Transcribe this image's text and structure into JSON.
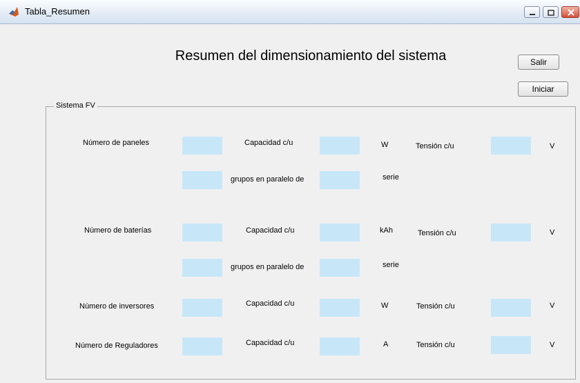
{
  "window": {
    "title": "Tabla_Resumen",
    "icon": "matlab-icon",
    "controls": [
      "minimize-icon",
      "maximize-icon",
      "close-icon"
    ]
  },
  "heading": "Resumen del dimensionamiento del sistema",
  "buttons": {
    "exit": "Salir",
    "start": "Iniciar"
  },
  "panel": {
    "title": "Sistema FV",
    "panels": {
      "label": "Número de paneles",
      "capacity_label": "Capacidad c/u",
      "capacity_unit": "W",
      "voltage_label": "Tensión c/u",
      "voltage_unit": "V",
      "groups_label": "grupos en  paralelo de",
      "series_label": "serie"
    },
    "batteries": {
      "label": "Número de baterías",
      "capacity_label": "Capacidad c/u",
      "capacity_unit": "kAh",
      "voltage_label": "Tensión c/u",
      "voltage_unit": "V",
      "groups_label": "grupos en  paralelo de",
      "series_label": "serie"
    },
    "inverters": {
      "label": "Número de inversores",
      "capacity_label": "Capacidad c/u",
      "capacity_unit": "W",
      "voltage_label": "Tensión c/u",
      "voltage_unit": "V"
    },
    "regulators": {
      "label": "Número de Reguladores",
      "capacity_label": "Capacidad c/u",
      "capacity_unit": "A",
      "voltage_label": "Tensión c/u",
      "voltage_unit": "V"
    }
  },
  "colors": {
    "field": "#c7e7f9",
    "background": "#f0f0f0"
  }
}
